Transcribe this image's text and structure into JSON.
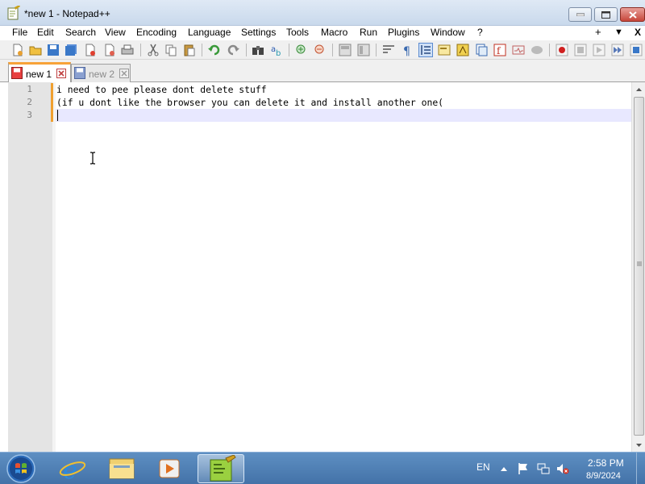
{
  "window": {
    "title": "*new 1 - Notepad++"
  },
  "menu": {
    "items": [
      "File",
      "Edit",
      "Search",
      "View",
      "Encoding",
      "Language",
      "Settings",
      "Tools",
      "Macro",
      "Run",
      "Plugins",
      "Window",
      "?"
    ],
    "right_plus": "+",
    "right_down": "▼",
    "right_close": "X"
  },
  "tabs": [
    {
      "label": "new 1",
      "active": true
    },
    {
      "label": "new 2",
      "active": false
    }
  ],
  "editor": {
    "line_numbers": [
      "1",
      "2",
      "3"
    ],
    "lines": [
      "i need to pee please dont delete stuff",
      "(if u dont like the browser you can delete it and install another one(",
      ""
    ]
  },
  "tray": {
    "language": "EN",
    "time": "2:58 PM",
    "date": "8/9/2024"
  },
  "colors": {
    "tab_accent": "#f7a238",
    "taskbar": "#4a7bb0",
    "current_line": "#e8e8ff"
  }
}
